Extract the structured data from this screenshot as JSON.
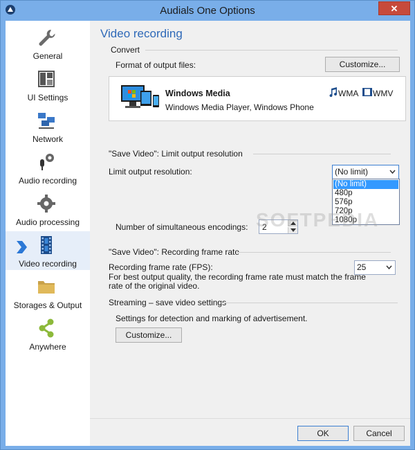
{
  "window": {
    "title": "Audials One Options",
    "close_label": "✕"
  },
  "sidebar": {
    "items": [
      {
        "label": "General",
        "icon": "wrench-icon"
      },
      {
        "label": "UI Settings",
        "icon": "layout-icon"
      },
      {
        "label": "Network",
        "icon": "network-icon"
      },
      {
        "label": "Audio recording",
        "icon": "microphone-gear-icon"
      },
      {
        "label": "Audio processing",
        "icon": "gear-icon"
      },
      {
        "label": "Video recording",
        "icon": "film-icon"
      },
      {
        "label": "Storages & Output",
        "icon": "folder-icon"
      },
      {
        "label": "Anywhere",
        "icon": "share-icon"
      }
    ],
    "active_index": 5
  },
  "content": {
    "heading": "Video recording",
    "convert": {
      "group_label": "Convert",
      "format_label": "Format of output files:",
      "customize_label": "Customize...",
      "format_name": "Windows Media",
      "format_desc": "Windows Media Player, Windows Phone",
      "audio_ext": "WMA",
      "video_ext": "WMV"
    },
    "resolution": {
      "group_label": "\"Save Video\": Limit output resolution",
      "limit_label": "Limit output resolution:",
      "selected": "(No limit)",
      "options": [
        "(No limit)",
        "480p",
        "576p",
        "720p",
        "1080p"
      ]
    },
    "encodings": {
      "label": "Number of simultaneous encodings:",
      "value": "2"
    },
    "framerate": {
      "group_label": "\"Save Video\": Recording frame rate",
      "label": "Recording frame rate (FPS):",
      "hint_line1": "For best output quality, the recording frame rate must match the frame",
      "hint_line2": "rate of the original video.",
      "value": "25"
    },
    "streaming": {
      "group_label": "Streaming – save video settings",
      "desc": "Settings for detection and marking of advertisement.",
      "customize_label": "Customize..."
    }
  },
  "footer": {
    "ok_label": "OK",
    "cancel_label": "Cancel"
  },
  "watermark": "SOFTPEDIA",
  "colors": {
    "accent": "#2e69b8",
    "titlebar": "#79aee9",
    "selection": "#3399ff",
    "close": "#c74a3b"
  }
}
